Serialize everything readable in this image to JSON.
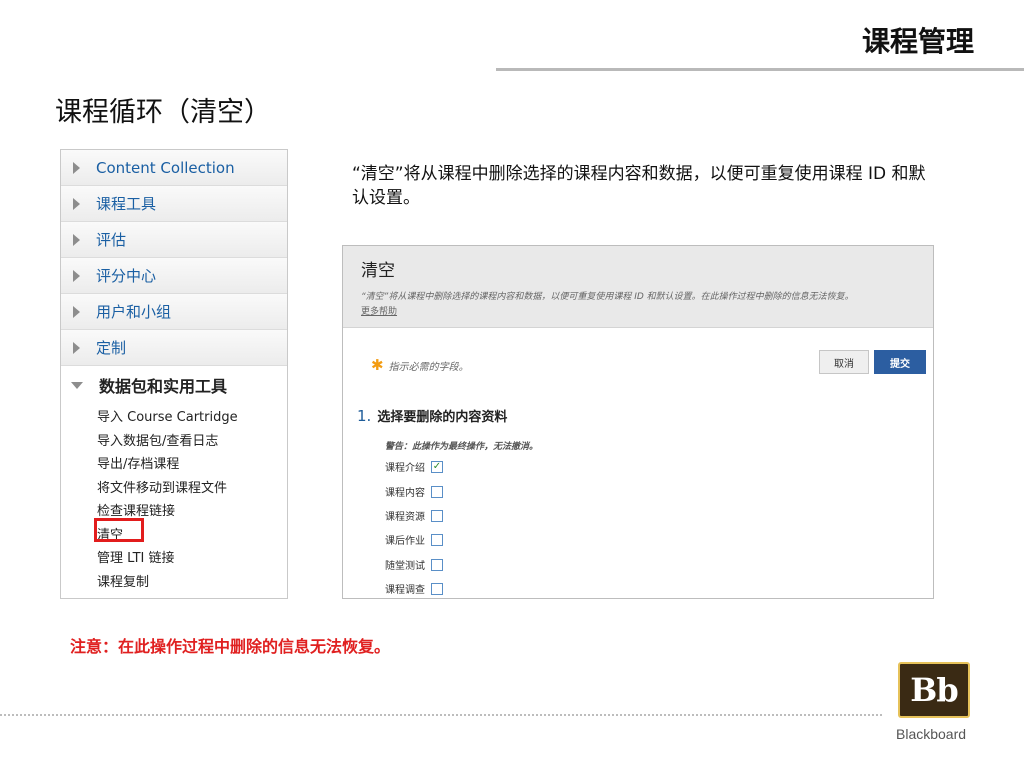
{
  "header": {
    "title": "课程管理"
  },
  "page_title": "课程循环（清空）",
  "menu": {
    "items": [
      {
        "label": "Content Collection"
      },
      {
        "label": "课程工具"
      },
      {
        "label": "评估"
      },
      {
        "label": "评分中心"
      },
      {
        "label": "用户和小组"
      },
      {
        "label": "定制"
      }
    ],
    "open_section": {
      "label": "数据包和实用工具"
    },
    "sub_items": [
      {
        "label": "导入 Course Cartridge"
      },
      {
        "label": "导入数据包/查看日志"
      },
      {
        "label": "导出/存档课程"
      },
      {
        "label": "将文件移动到课程文件"
      },
      {
        "label": "检查课程链接"
      },
      {
        "label": "清空"
      },
      {
        "label": "管理 LTI 链接"
      },
      {
        "label": "课程复制"
      }
    ]
  },
  "description": "“清空”将从课程中删除选择的课程内容和数据，以便可重复使用课程 ID 和默认设置。",
  "panel": {
    "title": "清空",
    "subtitle": "“清空”将从课程中删除选择的课程内容和数据，以便可重复使用课程 ID 和默认设置。在此操作过程中删除的信息无法恢复。",
    "help_link": "更多帮助",
    "required_note": "指示必需的字段。",
    "cancel_label": "取消",
    "submit_label": "提交",
    "step_number": "1.",
    "step_title": "选择要删除的内容资料",
    "warning": "警告：此操作为最终操作，无法撤消。",
    "options": [
      {
        "label": "课程介绍",
        "checked": true
      },
      {
        "label": "课程内容",
        "checked": false
      },
      {
        "label": "课程资源",
        "checked": false
      },
      {
        "label": "课后作业",
        "checked": false
      },
      {
        "label": "随堂测试",
        "checked": false
      },
      {
        "label": "课程调查",
        "checked": false
      }
    ]
  },
  "note": "注意：在此操作过程中删除的信息无法恢复。",
  "logo": {
    "mark": "Bb",
    "wordmark": "Blackboard"
  },
  "colors": {
    "link": "#1a5fa3",
    "highlight": "#e21c1c",
    "submit": "#2c5ea1",
    "note": "#e02020"
  }
}
